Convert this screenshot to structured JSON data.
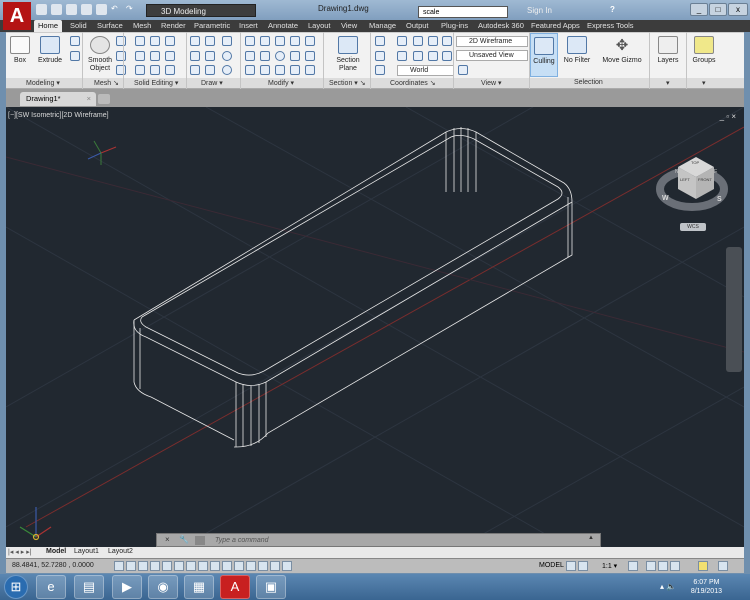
{
  "app": {
    "logo": "A",
    "workspace": "3D Modeling",
    "document_title": "Drawing1.dwg",
    "search_value": "scale",
    "sign_in": "Sign In"
  },
  "ribbon_tabs": [
    "Home",
    "Solid",
    "Surface",
    "Mesh",
    "Render",
    "Parametric",
    "Insert",
    "Annotate",
    "Layout",
    "View",
    "Manage",
    "Output",
    "Plug-ins",
    "Autodesk 360",
    "Featured Apps",
    "Express Tools"
  ],
  "buttons": {
    "box": "Box",
    "extrude": "Extrude",
    "smooth_object_1": "Smooth",
    "smooth_object_2": "Object",
    "section_plane_1": "Section",
    "section_plane_2": "Plane",
    "culling": "Culling",
    "no_filter": "No Filter",
    "move_gizmo": "Move Gizmo",
    "layers": "Layers",
    "groups": "Groups"
  },
  "combos": {
    "visual_style": "2D Wireframe",
    "view": "Unsaved View",
    "ucs": "World"
  },
  "panels": [
    "Modeling ▾",
    "Mesh ↘",
    "Solid Editing ▾",
    "Draw ▾",
    "Modify ▾",
    "Section ▾ ↘",
    "Coordinates ↘",
    "View ▾",
    "Selection",
    "▾",
    "▾"
  ],
  "doc_tab": "Drawing1*",
  "viewport": {
    "label": "[−][SW Isometric][2D Wireframe]",
    "viewcube": {
      "top": "TOP",
      "left": "LEFT",
      "front": "FRONT",
      "w": "W",
      "s": "S",
      "n": "N",
      "e": "E",
      "wcs": "WCS"
    }
  },
  "command_line": {
    "placeholder": "Type a command"
  },
  "layout_tabs": [
    "Model",
    "Layout1",
    "Layout2"
  ],
  "status": {
    "coords": "88.4841, 52.7280 , 0.0000",
    "model": "MODEL",
    "scale": "1:1 ▾"
  },
  "taskbar": {
    "time": "6:07 PM",
    "date": "8/19/2013"
  },
  "colors": {
    "viewport_bg": "#212830",
    "autocad_red": "#b41414",
    "ribbon_dark": "#3c3c3c"
  }
}
